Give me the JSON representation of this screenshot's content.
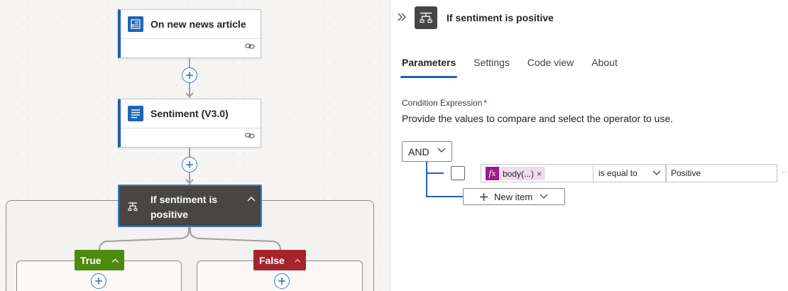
{
  "workflow": {
    "trigger": {
      "title": "On new news article",
      "icon": "news-trigger-icon"
    },
    "action": {
      "title": "Sentiment (V3.0)",
      "icon": "text-analytics-icon"
    },
    "condition": {
      "title": "If sentiment is positive",
      "icon": "condition-icon"
    },
    "branches": {
      "true_label": "True",
      "false_label": "False"
    }
  },
  "panel": {
    "title": "If sentiment is positive",
    "tabs": [
      {
        "label": "Parameters",
        "active": true
      },
      {
        "label": "Settings",
        "active": false
      },
      {
        "label": "Code view",
        "active": false
      },
      {
        "label": "About",
        "active": false
      }
    ],
    "condition_expression": {
      "label": "Condition Expression",
      "required_marker": "*",
      "description": "Provide the values to compare and select the operator to use.",
      "group_operator": "AND",
      "row": {
        "left_token": "body(...)",
        "token_remove": "×",
        "operator": "is equal to",
        "right_value": "Positive",
        "more": "··"
      },
      "new_item_label": "New item"
    }
  },
  "colors": {
    "accent": "#1f64b4",
    "true_branch": "#4d8a10",
    "false_branch": "#a4262c",
    "condition_node": "#484644",
    "expression_token": "#9b1a8e"
  }
}
